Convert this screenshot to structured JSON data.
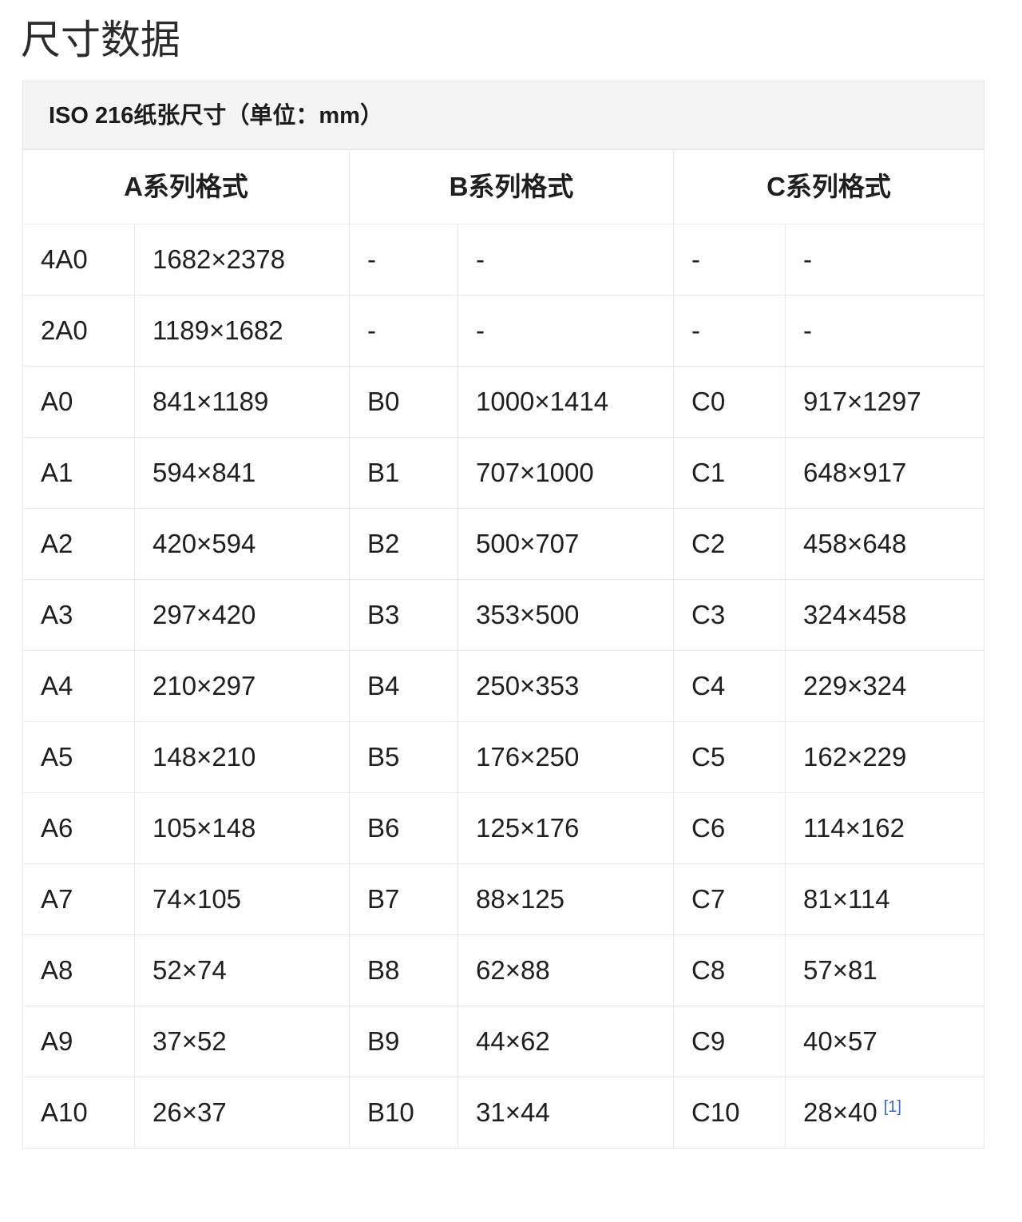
{
  "page": {
    "title": "尺寸数据"
  },
  "table": {
    "caption": "ISO 216纸张尺寸（单位：mm）",
    "group_headers": [
      {
        "label": "A系列格式",
        "colspan": 2
      },
      {
        "label": "B系列格式",
        "colspan": 2
      },
      {
        "label": "C系列格式",
        "colspan": 2
      }
    ],
    "footnote_marker": "[1]",
    "rows": [
      {
        "a_name": "4A0",
        "a_size": "1682×2378",
        "b_name": "-",
        "b_size": "-",
        "c_name": "-",
        "c_size": "-"
      },
      {
        "a_name": "2A0",
        "a_size": "1189×1682",
        "b_name": "-",
        "b_size": "-",
        "c_name": "-",
        "c_size": "-"
      },
      {
        "a_name": "A0",
        "a_size": "841×1189",
        "b_name": "B0",
        "b_size": "1000×1414",
        "c_name": "C0",
        "c_size": "917×1297"
      },
      {
        "a_name": "A1",
        "a_size": "594×841",
        "b_name": "B1",
        "b_size": "707×1000",
        "c_name": "C1",
        "c_size": "648×917"
      },
      {
        "a_name": "A2",
        "a_size": "420×594",
        "b_name": "B2",
        "b_size": "500×707",
        "c_name": "C2",
        "c_size": "458×648"
      },
      {
        "a_name": "A3",
        "a_size": "297×420",
        "b_name": "B3",
        "b_size": "353×500",
        "c_name": "C3",
        "c_size": "324×458"
      },
      {
        "a_name": "A4",
        "a_size": "210×297",
        "b_name": "B4",
        "b_size": "250×353",
        "c_name": "C4",
        "c_size": "229×324"
      },
      {
        "a_name": "A5",
        "a_size": "148×210",
        "b_name": "B5",
        "b_size": "176×250",
        "c_name": "C5",
        "c_size": "162×229"
      },
      {
        "a_name": "A6",
        "a_size": "105×148",
        "b_name": "B6",
        "b_size": "125×176",
        "c_name": "C6",
        "c_size": "114×162"
      },
      {
        "a_name": "A7",
        "a_size": "74×105",
        "b_name": "B7",
        "b_size": "88×125",
        "c_name": "C7",
        "c_size": "81×114"
      },
      {
        "a_name": "A8",
        "a_size": "52×74",
        "b_name": "B8",
        "b_size": "62×88",
        "c_name": "C8",
        "c_size": "57×81"
      },
      {
        "a_name": "A9",
        "a_size": "37×52",
        "b_name": "B9",
        "b_size": "44×62",
        "c_name": "C9",
        "c_size": "40×57"
      },
      {
        "a_name": "A10",
        "a_size": "26×37",
        "b_name": "B10",
        "b_size": "31×44",
        "c_name": "C10",
        "c_size": "28×40",
        "c_size_footnote": "[1]"
      }
    ]
  },
  "colors": {
    "caption_background": "#f4f4f4",
    "border": "#e9e9e9",
    "text": "#1f1f1f",
    "title": "#2b2b2b",
    "link": "#3366cc"
  }
}
